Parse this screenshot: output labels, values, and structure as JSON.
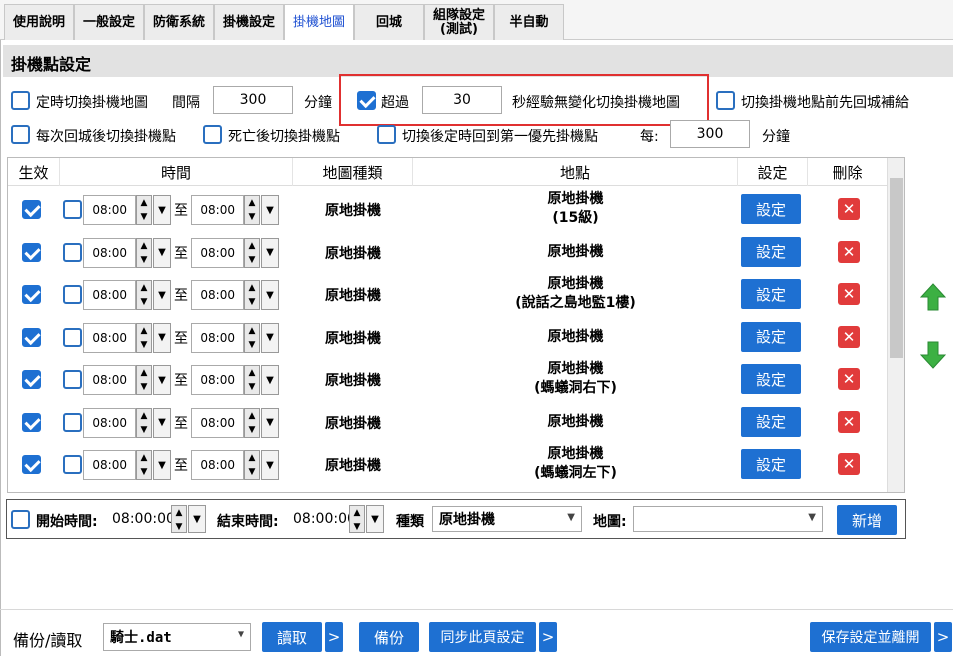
{
  "tabs": [
    {
      "label": "使用說明",
      "active": false
    },
    {
      "label": "一般設定",
      "active": false
    },
    {
      "label": "防衛系統",
      "active": false
    },
    {
      "label": "掛機設定",
      "active": false
    },
    {
      "label": "掛機地圖",
      "active": true
    },
    {
      "label": "回城",
      "active": false
    },
    {
      "label": "組隊設定\n(測試)",
      "active": false
    },
    {
      "label": "半自動",
      "active": false
    }
  ],
  "section_title": "掛機點設定",
  "options": {
    "timed_switch": {
      "label": "定時切換掛機地圖",
      "checked": false
    },
    "interval_label": "間隔",
    "interval_value": "300",
    "minutes_label": "分鐘",
    "exceed": {
      "label": "超過",
      "checked": true
    },
    "exceed_value": "30",
    "exceed_suffix": "秒經驗無變化切換掛機地圖",
    "return_supply": {
      "label": "切換掛機地點前先回城補給",
      "checked": false
    },
    "switch_after_return": {
      "label": "每次回城後切換掛機點",
      "checked": false
    },
    "switch_after_death": {
      "label": "死亡後切換掛機點",
      "checked": false
    },
    "back_to_first": {
      "label": "切換後定時回到第一優先掛機點",
      "checked": false
    },
    "every_label": "每:",
    "every_value": "300",
    "every_minutes": "分鐘"
  },
  "grid": {
    "headers": {
      "enabled": "生效",
      "time": "時間",
      "map_type": "地圖種類",
      "place": "地點",
      "settings": "設定",
      "delete": "刪除"
    },
    "to_label": "至",
    "rows": [
      {
        "enabled": true,
        "timed": false,
        "start": "08:00",
        "end": "08:00",
        "map_type": "原地掛機",
        "place": "原地掛機\n(15級)",
        "set_label": "設定"
      },
      {
        "enabled": true,
        "timed": false,
        "start": "08:00",
        "end": "08:00",
        "map_type": "原地掛機",
        "place": "原地掛機",
        "set_label": "設定"
      },
      {
        "enabled": true,
        "timed": false,
        "start": "08:00",
        "end": "08:00",
        "map_type": "原地掛機",
        "place": "原地掛機\n(說話之島地監1樓)",
        "set_label": "設定"
      },
      {
        "enabled": true,
        "timed": false,
        "start": "08:00",
        "end": "08:00",
        "map_type": "原地掛機",
        "place": "原地掛機",
        "set_label": "設定"
      },
      {
        "enabled": true,
        "timed": false,
        "start": "08:00",
        "end": "08:00",
        "map_type": "原地掛機",
        "place": "原地掛機\n(螞蟻洞右下)",
        "set_label": "設定"
      },
      {
        "enabled": true,
        "timed": false,
        "start": "08:00",
        "end": "08:00",
        "map_type": "原地掛機",
        "place": "原地掛機",
        "set_label": "設定"
      },
      {
        "enabled": true,
        "timed": false,
        "start": "08:00",
        "end": "08:00",
        "map_type": "原地掛機",
        "place": "原地掛機\n(螞蟻洞左下)",
        "set_label": "設定"
      }
    ]
  },
  "add_bar": {
    "start_label": "開始時間:",
    "start_value": "08:00:00",
    "end_label": "結束時間:",
    "end_value": "08:00:00",
    "type_label": "種類",
    "type_value": "原地掛機",
    "map_label": "地圖:",
    "map_value": "",
    "add_label": "新增"
  },
  "footer": {
    "backup_label": "備份/讀取",
    "file_value": "騎士.dat",
    "read_label": "讀取",
    "backup_btn": "備份",
    "sync_label": "同步此頁設定",
    "save_label": "保存設定並離開",
    "more_glyph": ">"
  },
  "colors": {
    "accent": "#1e70d2",
    "danger": "#e13b3b",
    "highlight": "#e03030",
    "arrow": "#3cb043"
  }
}
